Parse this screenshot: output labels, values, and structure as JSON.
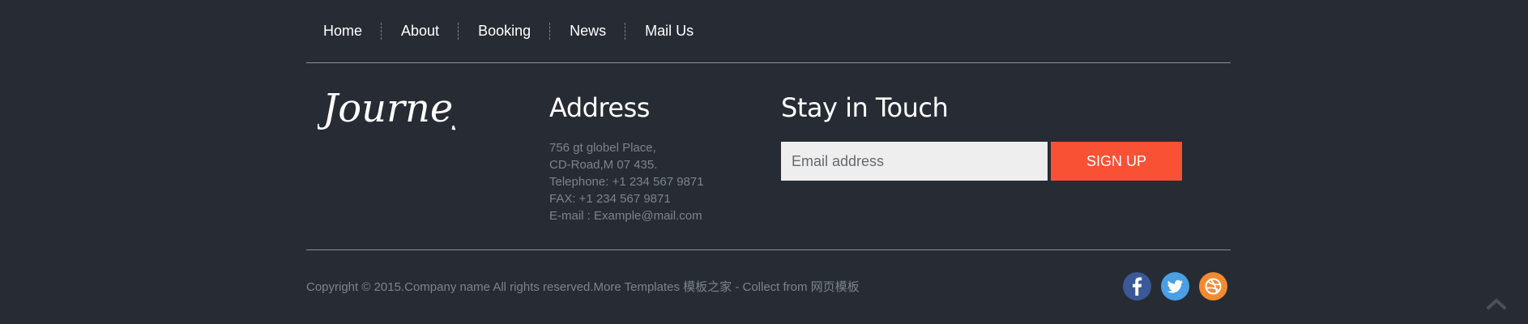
{
  "nav": {
    "items": [
      {
        "label": "Home"
      },
      {
        "label": "About"
      },
      {
        "label": "Booking"
      },
      {
        "label": "News"
      },
      {
        "label": "Mail Us"
      }
    ]
  },
  "logo": {
    "text": "Journey"
  },
  "address": {
    "heading": "Address",
    "lines": [
      "756 gt globel Place,",
      "CD-Road,M 07 435.",
      "Telephone: +1 234 567 9871",
      "FAX: +1 234 567 9871",
      "E-mail : Example@mail.com"
    ]
  },
  "touch": {
    "heading": "Stay in Touch",
    "email_placeholder": "Email address",
    "signup_label": "SIGN UP"
  },
  "footer": {
    "copyright": "Copyright © 2015.Company name All rights reserved.More Templates 模板之家 - Collect from 网页模板",
    "social": [
      {
        "icon": "facebook-icon",
        "color": "#3b5998"
      },
      {
        "icon": "twitter-icon",
        "color": "#4a9fe5"
      },
      {
        "icon": "dribbble-icon",
        "color": "#f28b30"
      }
    ]
  },
  "colors": {
    "background": "#272c34",
    "accent": "#f95134",
    "muted_text": "#7d838b"
  }
}
